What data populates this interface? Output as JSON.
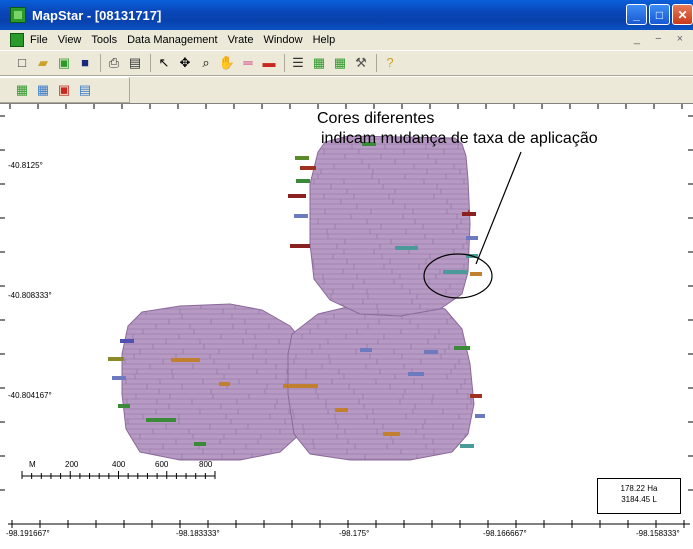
{
  "window": {
    "title": "MapStar - [08131717]"
  },
  "menu": {
    "items": [
      "File",
      "View",
      "Tools",
      "Data Management",
      "Vrate",
      "Window",
      "Help"
    ],
    "mdi_controls": "_ − ×"
  },
  "toolbar": {
    "row1": [
      {
        "icon": "new-file-icon",
        "glyph": "□",
        "color": "#333"
      },
      {
        "icon": "open-folder-icon",
        "glyph": "▰",
        "color": "#c9a227"
      },
      {
        "icon": "import-log-icon",
        "glyph": "▣",
        "color": "#2c9a2a"
      },
      {
        "icon": "save-icon",
        "glyph": "■",
        "color": "#1a2a7a"
      },
      {
        "sep": true
      },
      {
        "icon": "print-icon",
        "glyph": "⎙",
        "color": "#333"
      },
      {
        "icon": "print-preview-icon",
        "glyph": "▤",
        "color": "#333"
      },
      {
        "sep": true
      },
      {
        "icon": "pointer-icon",
        "glyph": "↖",
        "color": "#000"
      },
      {
        "icon": "pan-icon",
        "glyph": "✥",
        "color": "#000"
      },
      {
        "icon": "zoom-icon",
        "glyph": "⌕",
        "color": "#000"
      },
      {
        "icon": "hand-icon",
        "glyph": "✋",
        "color": "#333"
      },
      {
        "icon": "line-icon",
        "glyph": "═",
        "color": "#d4287a"
      },
      {
        "icon": "layer-icon",
        "glyph": "▬",
        "color": "#c8281e"
      },
      {
        "sep": true
      },
      {
        "icon": "list-icon",
        "glyph": "☰",
        "color": "#333"
      },
      {
        "icon": "log-icon",
        "glyph": "▦",
        "color": "#2c9a2a"
      },
      {
        "icon": "stats-icon",
        "glyph": "▦",
        "color": "#2c9a2a"
      },
      {
        "icon": "tools-icon",
        "glyph": "⚒",
        "color": "#555"
      },
      {
        "sep": true
      },
      {
        "icon": "help-icon",
        "glyph": "?",
        "color": "#c9a227"
      }
    ],
    "row2": [
      {
        "icon": "map-layer-icon",
        "glyph": "▦",
        "color": "#2c9a2a"
      },
      {
        "icon": "map-edit-icon",
        "glyph": "▦",
        "color": "#3a7ac8"
      },
      {
        "icon": "map-export-icon",
        "glyph": "▣",
        "color": "#c8281e"
      },
      {
        "icon": "hpt-icon",
        "glyph": "▤",
        "color": "#3a7ac8"
      }
    ]
  },
  "map": {
    "y_labels": [
      "-40.8125°",
      "-40.808333°",
      "-40.804167°"
    ],
    "x_labels": [
      "-98.191667°",
      "-98.183333°",
      "-98.175°",
      "-98.166667°",
      "-98.158333°"
    ],
    "field_color": "#b79ac4",
    "annotation": {
      "line1": "Cores diferentes",
      "line2": "indicam mudança de taxa de aplicação"
    },
    "scale_bar": {
      "unit": "M",
      "ticks": [
        "200",
        "400",
        "600",
        "800"
      ]
    },
    "legend": {
      "area": "178.22 Ha",
      "volume": "3184.45 L"
    },
    "rate_colors": [
      "#6d7ac0",
      "#4a9a9a",
      "#3a8a3a",
      "#8a8a2a",
      "#a03020",
      "#c08030",
      "#5050b0",
      "#8b2020"
    ]
  }
}
